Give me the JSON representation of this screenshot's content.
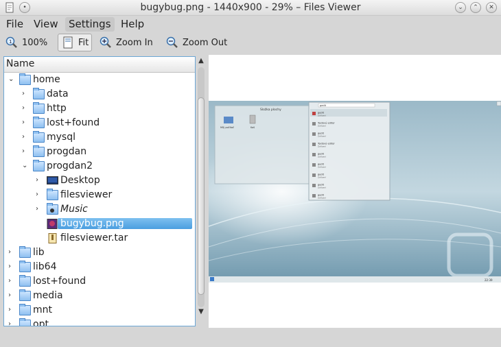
{
  "window": {
    "title": "bugybug.png - 1440x900 - 29% – Files Viewer"
  },
  "menu": [
    "File",
    "View",
    "Settings",
    "Help"
  ],
  "toolbar": {
    "zoom_actual": "100%",
    "fit": "Fit",
    "zoom_in": "Zoom In",
    "zoom_out": "Zoom Out"
  },
  "tree": {
    "header": "Name",
    "items": [
      {
        "label": "home",
        "level": 0,
        "expanded": true,
        "icon": "folder-icon"
      },
      {
        "label": "data",
        "level": 1,
        "expanded": false,
        "icon": "folder-icon"
      },
      {
        "label": "http",
        "level": 1,
        "expanded": false,
        "icon": "folder-icon"
      },
      {
        "label": "lost+found",
        "level": 1,
        "expanded": false,
        "icon": "folder-icon"
      },
      {
        "label": "mysql",
        "level": 1,
        "expanded": false,
        "icon": "folder-icon"
      },
      {
        "label": "progdan",
        "level": 1,
        "expanded": false,
        "icon": "folder-icon"
      },
      {
        "label": "progdan2",
        "level": 1,
        "expanded": true,
        "icon": "folder-icon"
      },
      {
        "label": "Desktop",
        "level": 2,
        "expanded": false,
        "icon": "desktop-icon"
      },
      {
        "label": "filesviewer",
        "level": 2,
        "expanded": false,
        "icon": "folder-icon"
      },
      {
        "label": "Music",
        "level": 2,
        "expanded": false,
        "icon": "music-folder-icon"
      },
      {
        "label": "bugybug.png",
        "level": 2,
        "selected": true,
        "icon": "image-file-icon"
      },
      {
        "label": "filesviewer.tar",
        "level": 2,
        "icon": "archive-file-icon"
      },
      {
        "label": "lib",
        "level": 0,
        "expanded": false,
        "icon": "folder-icon"
      },
      {
        "label": "lib64",
        "level": 0,
        "expanded": false,
        "icon": "folder-icon"
      },
      {
        "label": "lost+found",
        "level": 0,
        "expanded": false,
        "icon": "folder-icon"
      },
      {
        "label": "media",
        "level": 0,
        "expanded": false,
        "icon": "folder-icon"
      },
      {
        "label": "mnt",
        "level": 0,
        "expanded": false,
        "icon": "folder-icon"
      },
      {
        "label": "opt",
        "level": 0,
        "expanded": false,
        "icon": "folder-icon"
      }
    ]
  },
  "preview": {
    "desktop_window_title": "Složka plochy",
    "desktop_icons": [
      "Můj počítač",
      "Koš"
    ],
    "search_text": "gedit",
    "result_items": [
      {
        "name": "gedit",
        "sub": "Zařízení"
      },
      {
        "name": "Textový editor",
        "sub": "Zařízení"
      },
      {
        "name": "gedit",
        "sub": "Zařízení"
      },
      {
        "name": "Textový editor",
        "sub": "Zařízení"
      },
      {
        "name": "gedit",
        "sub": "Zařízení"
      },
      {
        "name": "gedit",
        "sub": "Zařízení"
      },
      {
        "name": "gedit",
        "sub": "Zařízení"
      },
      {
        "name": "gedit",
        "sub": "Zařízení"
      },
      {
        "name": "gedit",
        "sub": "Zařízení"
      }
    ],
    "clock": "22:39"
  },
  "colors": {
    "selection": "#4a9ee0",
    "panel_border": "#6ba6d5",
    "folder": "#8fc0f0"
  }
}
